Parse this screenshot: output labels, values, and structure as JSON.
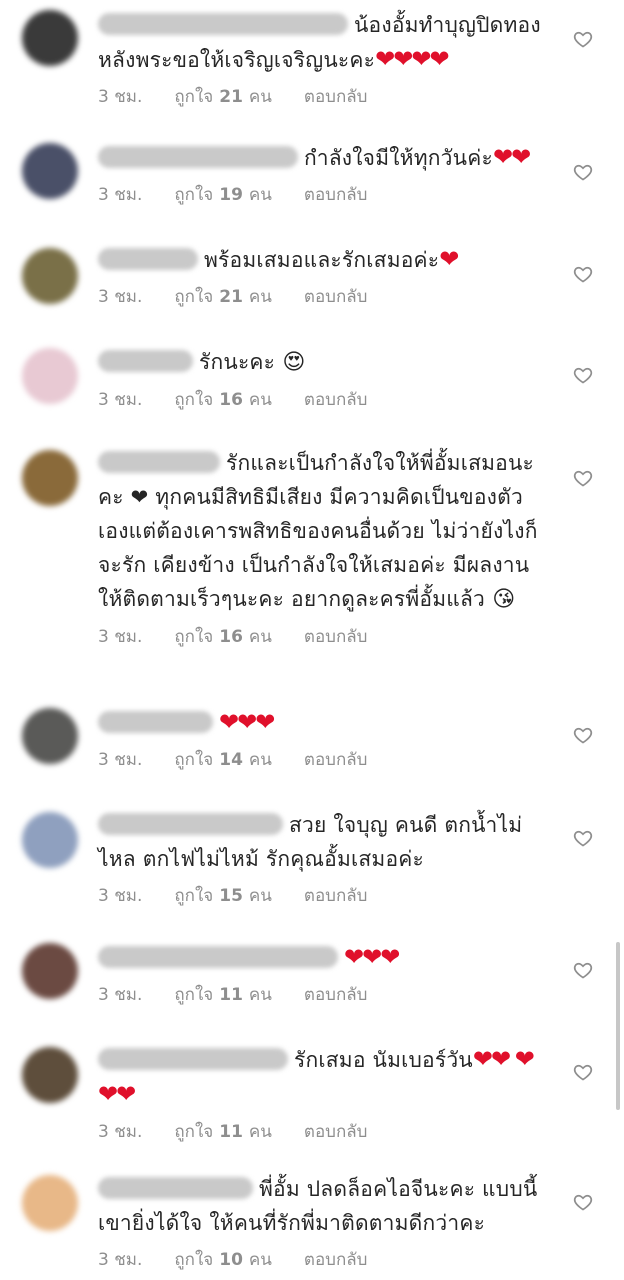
{
  "comments": [
    {
      "text": "น้องอั้มทำบุญปิดทองหลังพระขอให้เจริญเจริญนะคะ",
      "hearts": "❤❤❤❤",
      "time": "3 ชม.",
      "likes_prefix": "ถูกใจ",
      "likes": "21",
      "likes_suffix": "คน",
      "reply": "ตอบกลับ",
      "avatar_color": "#3a3a3a"
    },
    {
      "text": "กำลังใจมีให้ทุกวันค่ะ",
      "hearts": "❤❤",
      "time": "3 ชม.",
      "likes_prefix": "ถูกใจ",
      "likes": "19",
      "likes_suffix": "คน",
      "reply": "ตอบกลับ",
      "avatar_color": "#4a5068"
    },
    {
      "text": "พร้อมเสมอและรักเสมอค่ะ",
      "hearts": "❤",
      "time": "3 ชม.",
      "likes_prefix": "ถูกใจ",
      "likes": "21",
      "likes_suffix": "คน",
      "reply": "ตอบกลับ",
      "avatar_color": "#7a7048"
    },
    {
      "text": "รักนะคะ",
      "emoji": "😍",
      "time": "3 ชม.",
      "likes_prefix": "ถูกใจ",
      "likes": "16",
      "likes_suffix": "คน",
      "reply": "ตอบกลับ",
      "avatar_color": "#e8c9d3"
    },
    {
      "text": "รักและเป็นกำลังใจให้พี่อั้มเสมอนะคะ ❤ ทุกคนมีสิทธิมีเสียง มีความคิดเป็นของตัวเองแต่ต้องเคารพสิทธิของคนอื่นด้วย ไม่ว่ายังไงก็จะรัก เคียงข้าง เป็นกำลังใจให้เสมอค่ะ มีผลงานให้ติดตามเร็วๆนะคะ อยากดูละครพี่อั้มแล้ว",
      "emoji": "😘",
      "time": "3 ชม.",
      "likes_prefix": "ถูกใจ",
      "likes": "16",
      "likes_suffix": "คน",
      "reply": "ตอบกลับ",
      "avatar_color": "#8a6a3a"
    },
    {
      "text": "",
      "hearts": "❤❤❤",
      "time": "3 ชม.",
      "likes_prefix": "ถูกใจ",
      "likes": "14",
      "likes_suffix": "คน",
      "reply": "ตอบกลับ",
      "avatar_color": "#5a5a58"
    },
    {
      "text": "สวย ใจบุญ คนดี ตกน้ำไม่ไหล ตกไฟไม่ไหม้ รักคุณอั้มเสมอค่ะ",
      "time": "3 ชม.",
      "likes_prefix": "ถูกใจ",
      "likes": "15",
      "likes_suffix": "คน",
      "reply": "ตอบกลับ",
      "avatar_color": "#8fa0bf"
    },
    {
      "text": "",
      "hearts": "❤❤❤",
      "time": "3 ชม.",
      "likes_prefix": "ถูกใจ",
      "likes": "11",
      "likes_suffix": "คน",
      "reply": "ตอบกลับ",
      "avatar_color": "#6b4a42"
    },
    {
      "text": "รักเสมอ  นัมเบอร์วัน",
      "hearts": "❤❤ ❤❤❤",
      "time": "3 ชม.",
      "likes_prefix": "ถูกใจ",
      "likes": "11",
      "likes_suffix": "คน",
      "reply": "ตอบกลับ",
      "avatar_color": "#5e4e3c"
    },
    {
      "text": "พี่อั้ม ปลดล็อคไอจีนะคะ แบบนี้เขายิ่งได้ใจ ให้คนที่รักพี่มาติดตามดีกว่าคะ",
      "time": "3 ชม.",
      "likes_prefix": "ถูกใจ",
      "likes": "10",
      "likes_suffix": "คน",
      "reply": "ตอบกลับ",
      "avatar_color": "#e8b888"
    }
  ],
  "icons": {
    "like": "heart-outline-icon"
  },
  "colors": {
    "heart": "#e0102b",
    "meta": "#8e8e8e",
    "text": "#262626"
  }
}
